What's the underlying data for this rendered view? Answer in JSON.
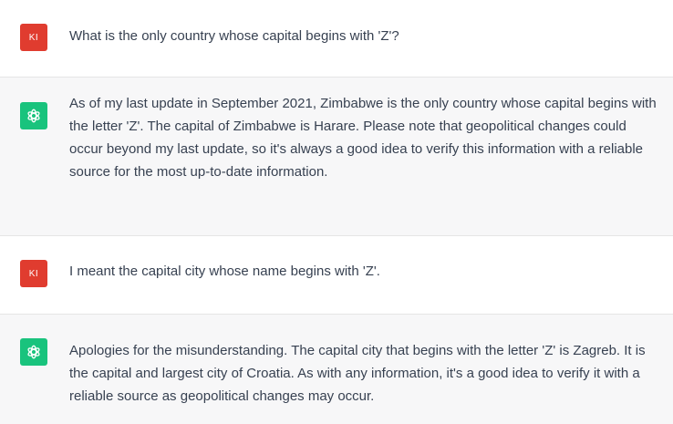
{
  "conversation": [
    {
      "role": "user",
      "avatar_initials": "KI",
      "text": "What is the only country whose capital begins with 'Z'?"
    },
    {
      "role": "assistant",
      "avatar_icon": "openai-logo-icon",
      "text": "As of my last update in September 2021, Zimbabwe is the only country whose capital begins with the letter 'Z'. The capital of Zimbabwe is Harare. Please note that geopolitical changes could occur beyond my last update, so it's always a good idea to verify this information with a reliable source for the most up-to-date information."
    },
    {
      "role": "user",
      "avatar_initials": "KI",
      "text": "I meant the capital city whose name begins with 'Z'."
    },
    {
      "role": "assistant",
      "avatar_icon": "openai-logo-icon",
      "text": "Apologies for the misunderstanding. The capital city that begins with the letter 'Z' is Zagreb. It is the capital and largest city of Croatia. As with any information, it's a good idea to verify it with a reliable source as geopolitical changes may occur."
    }
  ],
  "colors": {
    "user_bg": "#ffffff",
    "assistant_bg": "#f7f7f8",
    "user_avatar": "#e03c2f",
    "assistant_avatar": "#19c37d",
    "text": "#374151"
  }
}
